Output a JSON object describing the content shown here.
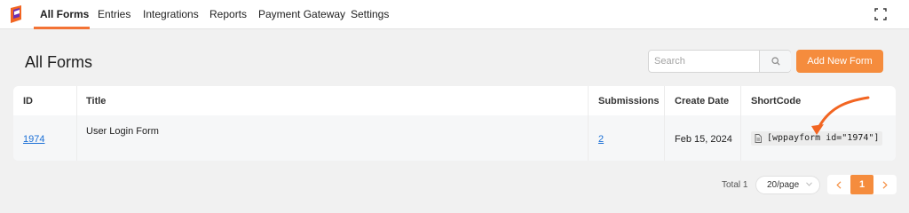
{
  "nav": {
    "items": [
      {
        "label": "All Forms",
        "active": true
      },
      {
        "label": "Entries"
      },
      {
        "label": "Integrations"
      },
      {
        "label": "Reports"
      },
      {
        "label": "Payment Gateway"
      },
      {
        "label": "Settings"
      }
    ],
    "icons": {
      "logo": "paymattic-logo-icon",
      "fullscreen": "fullscreen-icon"
    }
  },
  "header": {
    "title": "All Forms",
    "search_placeholder": "Search",
    "add_button": "Add New Form"
  },
  "table": {
    "columns": [
      "ID",
      "Title",
      "Submissions",
      "Create Date",
      "ShortCode"
    ],
    "rows": [
      {
        "id": "1974",
        "title": "User Login Form",
        "submissions": "2",
        "create_date": "Feb 15, 2024",
        "shortcode": "[wppayform id=\"1974\"]"
      }
    ]
  },
  "pagination": {
    "total": "Total 1",
    "page_size": "20/page",
    "current_page": "1"
  },
  "colors": {
    "accent": "#f58c3d",
    "link": "#1a6fd6",
    "annotation_arrow": "#f26522"
  }
}
